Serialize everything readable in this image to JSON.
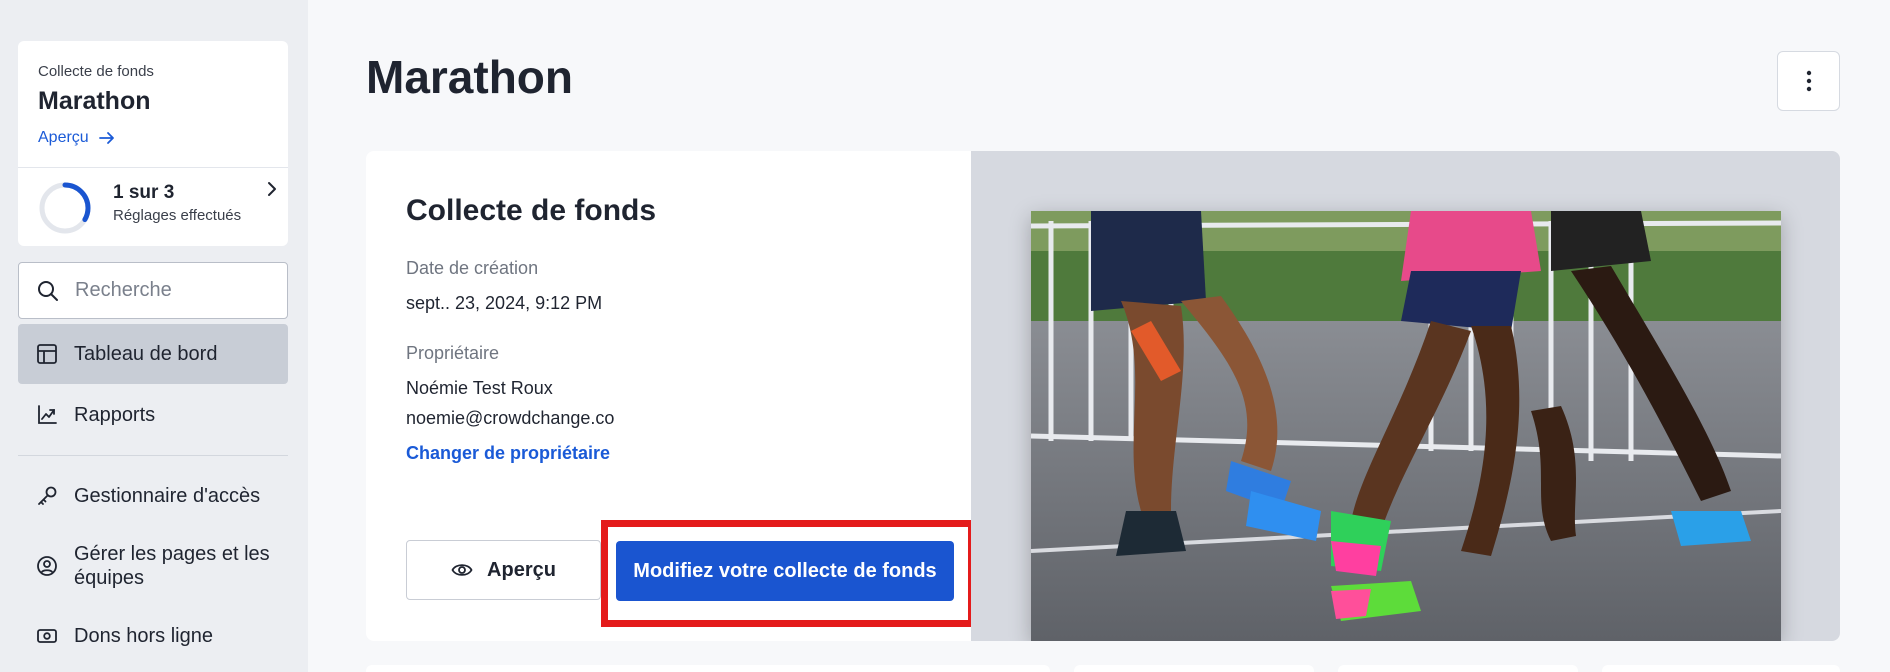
{
  "sidebar": {
    "campaign": {
      "kicker": "Collecte de fonds",
      "name": "Marathon",
      "preview_link": "Aperçu"
    },
    "progress": {
      "count": "1 sur 3",
      "subtitle": "Réglages effectués",
      "completed": 1,
      "total": 3
    },
    "search": {
      "placeholder": "Recherche",
      "value": ""
    },
    "nav": [
      {
        "label": "Tableau de bord",
        "icon": "dashboard-icon",
        "active": true
      },
      {
        "label": "Rapports",
        "icon": "chart-icon",
        "active": false
      },
      {
        "label": "Gestionnaire d'accès",
        "icon": "key-icon",
        "active": false
      },
      {
        "label": "Gérer les pages et les équipes",
        "icon": "user-circle-icon",
        "active": false
      },
      {
        "label": "Dons hors ligne",
        "icon": "cash-icon",
        "active": false
      }
    ]
  },
  "header": {
    "title": "Marathon",
    "menu_icon": "more-vertical-icon"
  },
  "card": {
    "heading": "Collecte de fonds",
    "created_label": "Date de création",
    "created_value": "sept.. 23, 2024, 9:12 PM",
    "owner_label": "Propriétaire",
    "owner_name": "Noémie Test Roux",
    "owner_email": "noemie@crowdchange.co",
    "change_owner": "Changer de propriétaire",
    "preview_button": "Aperçu",
    "edit_button": "Modifiez votre collecte de fonds"
  },
  "colors": {
    "accent": "#1a55d0",
    "highlight": "#e41b1b",
    "sidebar_bg": "#eceef2",
    "active_nav": "#c8cdd6"
  }
}
